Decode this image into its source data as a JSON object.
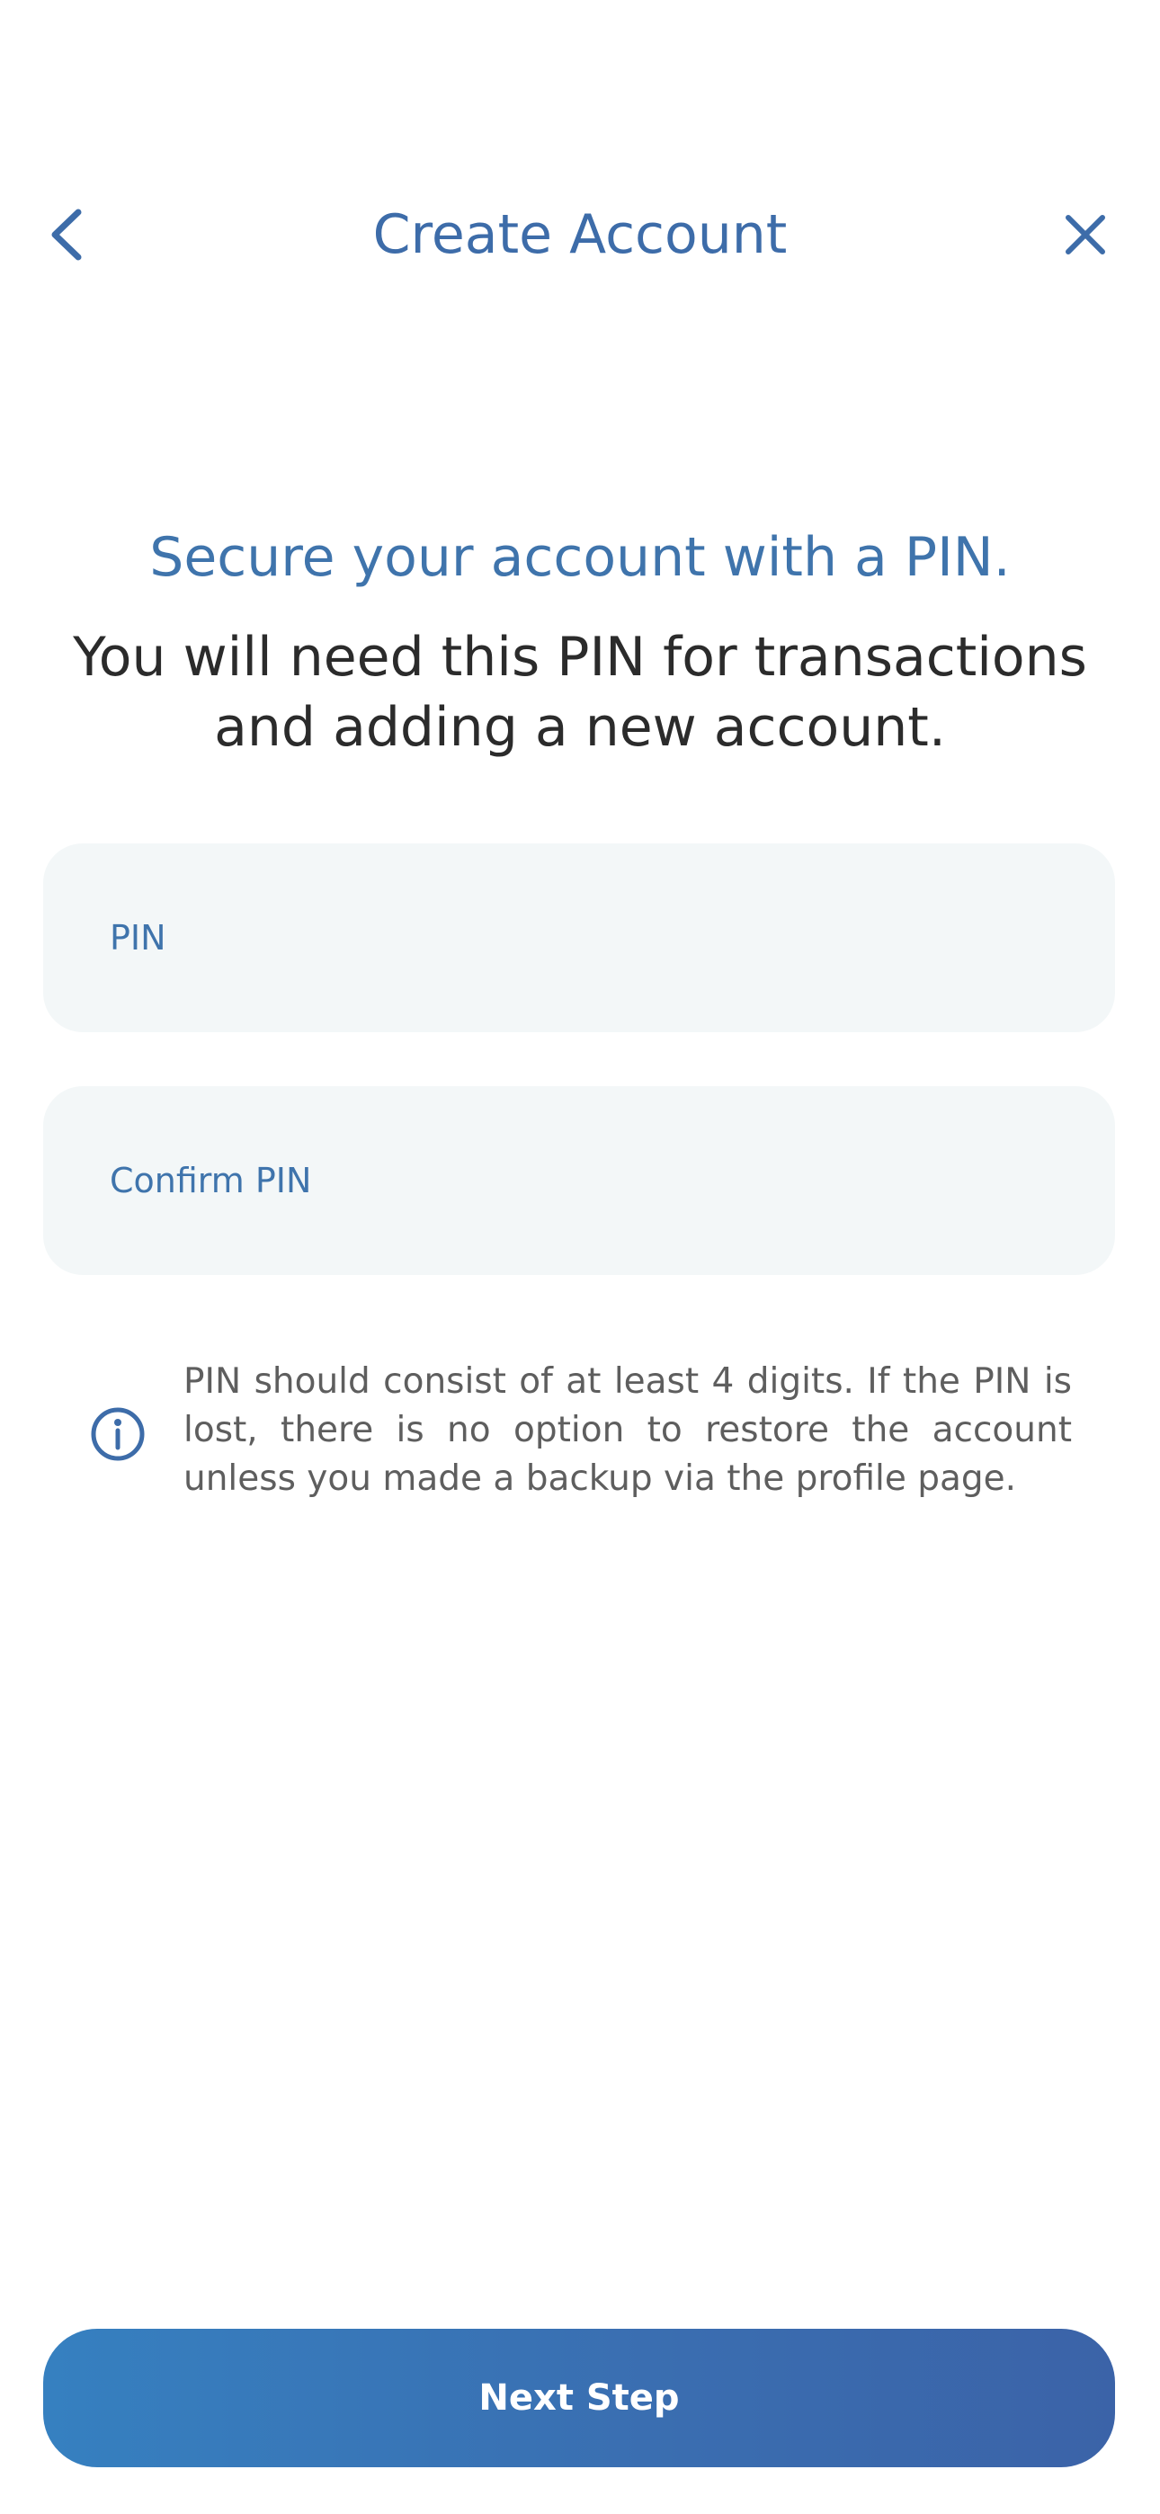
{
  "nav": {
    "title": "Create Account",
    "back_icon": "chevron-left-icon",
    "close_icon": "close-icon"
  },
  "intro": {
    "headline": "Secure your account with a PIN.",
    "subheadline": "You will need this PIN for transactions and adding a new account."
  },
  "form": {
    "pin": {
      "placeholder": "PIN",
      "value": ""
    },
    "confirm_pin": {
      "placeholder": "Confirm PIN",
      "value": ""
    }
  },
  "info": {
    "icon": "info-icon",
    "text": "PIN should consist of at least 4 digits. If the PIN is lost, there is no option to restore the account unless you made a backup via the profile page."
  },
  "actions": {
    "next_label": "Next Step"
  },
  "colors": {
    "accent": "#3d6ca9",
    "field_background": "#f3f7f8",
    "button_gradient_start": "#3680c0",
    "button_gradient_end": "#3b63a8"
  }
}
